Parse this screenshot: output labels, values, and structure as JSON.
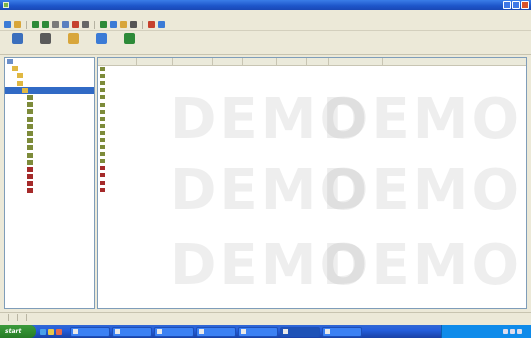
{
  "window": {
    "title": "",
    "controls": [
      "minimize-icon",
      "maximize-icon",
      "close-icon"
    ]
  },
  "menu": {
    "items": []
  },
  "toolbar_icons": [
    {
      "name": "new-icon",
      "color": "#3b7bd6"
    },
    {
      "name": "open-icon",
      "color": "#d8a63b"
    },
    {
      "name": "back-icon",
      "color": "#2d8a38"
    },
    {
      "name": "forward-icon",
      "color": "#2d8a38"
    },
    {
      "name": "cut-icon",
      "color": "#7a7a7a"
    },
    {
      "name": "copy-icon",
      "color": "#5a7fbf"
    },
    {
      "name": "delete-icon",
      "color": "#c6412d"
    },
    {
      "name": "properties-icon",
      "color": "#666666"
    },
    {
      "name": "refresh-icon",
      "color": "#2d8a38"
    },
    {
      "name": "find-icon",
      "color": "#3b7bd6"
    },
    {
      "name": "filter-icon",
      "color": "#d8a63b"
    },
    {
      "name": "print-icon",
      "color": "#555555"
    },
    {
      "name": "export-icon",
      "color": "#c6412d"
    },
    {
      "name": "help-icon",
      "color": "#3b7bd6"
    }
  ],
  "big_buttons": [
    {
      "name": "home-button",
      "label": "",
      "color": "#3b6fbd"
    },
    {
      "name": "tools-button",
      "label": "",
      "color": "#5a5a5a"
    },
    {
      "name": "filter-button",
      "label": "",
      "color": "#d8a63b"
    },
    {
      "name": "view-button",
      "label": "",
      "color": "#3b7bd6"
    },
    {
      "name": "stats-button",
      "label": "",
      "color": "#2d8a38"
    }
  ],
  "tree": {
    "items": [
      {
        "label": "",
        "indent": 0,
        "icon": "computer-icon",
        "color": "#6b8fc9",
        "selected": false
      },
      {
        "label": "",
        "indent": 1,
        "icon": "folder-icon",
        "color": "#e0b842",
        "selected": false
      },
      {
        "label": "",
        "indent": 2,
        "icon": "folder-icon",
        "color": "#e0b842",
        "selected": false
      },
      {
        "label": "",
        "indent": 2,
        "icon": "folder-icon",
        "color": "#e0b842",
        "selected": false
      },
      {
        "label": "",
        "indent": 3,
        "icon": "folder-icon",
        "color": "#e0b842",
        "selected": true
      },
      {
        "label": "",
        "indent": 4,
        "icon": "record-icon",
        "color": "#7d8b3a",
        "selected": false
      },
      {
        "label": "",
        "indent": 4,
        "icon": "record-icon",
        "color": "#7d8b3a",
        "selected": false
      },
      {
        "label": "",
        "indent": 4,
        "icon": "record-icon",
        "color": "#7d8b3a",
        "selected": false
      },
      {
        "label": "",
        "indent": 4,
        "icon": "record-icon",
        "color": "#7d8b3a",
        "selected": false
      },
      {
        "label": "",
        "indent": 4,
        "icon": "record-icon",
        "color": "#7d8b3a",
        "selected": false
      },
      {
        "label": "",
        "indent": 4,
        "icon": "record-icon",
        "color": "#7d8b3a",
        "selected": false
      },
      {
        "label": "",
        "indent": 4,
        "icon": "record-icon",
        "color": "#7d8b3a",
        "selected": false
      },
      {
        "label": "",
        "indent": 4,
        "icon": "record-icon",
        "color": "#7d8b3a",
        "selected": false
      },
      {
        "label": "",
        "indent": 4,
        "icon": "record-icon",
        "color": "#7d8b3a",
        "selected": false
      },
      {
        "label": "",
        "indent": 4,
        "icon": "record-icon",
        "color": "#7d8b3a",
        "selected": false
      },
      {
        "label": "",
        "indent": 4,
        "icon": "alert-record-icon",
        "color": "#a52a2a",
        "selected": false
      },
      {
        "label": "",
        "indent": 4,
        "icon": "alert-record-icon",
        "color": "#a52a2a",
        "selected": false
      },
      {
        "label": "",
        "indent": 4,
        "icon": "alert-record-icon",
        "color": "#a52a2a",
        "selected": false
      },
      {
        "label": "",
        "indent": 4,
        "icon": "alert-record-icon",
        "color": "#a52a2a",
        "selected": false
      }
    ]
  },
  "table": {
    "columns": [
      "",
      "",
      "",
      "",
      "",
      "",
      "",
      "",
      ""
    ],
    "rows": [
      {
        "icon_color": "#7d8b3a",
        "cells": [
          "",
          "",
          "",
          "",
          "",
          "",
          "",
          "",
          ""
        ]
      },
      {
        "icon_color": "#7d8b3a",
        "cells": [
          "",
          "",
          "",
          "",
          "",
          "",
          "",
          "",
          ""
        ]
      },
      {
        "icon_color": "#7d8b3a",
        "cells": [
          "",
          "",
          "",
          "",
          "",
          "",
          "",
          "",
          ""
        ]
      },
      {
        "icon_color": "#7d8b3a",
        "cells": [
          "",
          "",
          "",
          "",
          "",
          "",
          "",
          "",
          ""
        ]
      },
      {
        "icon_color": "#7d8b3a",
        "cells": [
          "",
          "",
          "",
          "",
          "",
          "",
          "",
          "",
          ""
        ]
      },
      {
        "icon_color": "#7d8b3a",
        "cells": [
          "",
          "",
          "",
          "",
          "",
          "",
          "",
          "",
          ""
        ]
      },
      {
        "icon_color": "#7d8b3a",
        "cells": [
          "",
          "",
          "",
          "",
          "",
          "",
          "",
          "",
          ""
        ]
      },
      {
        "icon_color": "#7d8b3a",
        "cells": [
          "",
          "",
          "",
          "",
          "",
          "",
          "",
          "",
          ""
        ]
      },
      {
        "icon_color": "#7d8b3a",
        "cells": [
          "",
          "",
          "",
          "",
          "",
          "",
          "",
          "",
          ""
        ]
      },
      {
        "icon_color": "#7d8b3a",
        "cells": [
          "",
          "",
          "",
          "",
          "",
          "",
          "",
          "",
          ""
        ]
      },
      {
        "icon_color": "#7d8b3a",
        "cells": [
          "",
          "",
          "",
          "",
          "",
          "",
          "",
          "",
          ""
        ]
      },
      {
        "icon_color": "#7d8b3a",
        "cells": [
          "",
          "",
          "",
          "",
          "",
          "",
          "",
          "",
          ""
        ]
      },
      {
        "icon_color": "#7d8b3a",
        "cells": [
          "",
          "",
          "",
          "",
          "",
          "",
          "",
          "",
          ""
        ]
      },
      {
        "icon_color": "#7d8b3a",
        "cells": [
          "",
          "",
          "",
          "",
          "",
          "",
          "",
          "",
          ""
        ]
      },
      {
        "icon_color": "#a52a2a",
        "cells": [
          "",
          "",
          "",
          "",
          "",
          "",
          "",
          "",
          ""
        ]
      },
      {
        "icon_color": "#a52a2a",
        "cells": [
          "",
          "",
          "",
          "",
          "",
          "",
          "",
          "",
          ""
        ]
      },
      {
        "icon_color": "#a52a2a",
        "cells": [
          "",
          "",
          "",
          "",
          "",
          "",
          "",
          "",
          ""
        ]
      },
      {
        "icon_color": "#a52a2a",
        "cells": [
          "",
          "",
          "",
          "",
          "",
          "",
          "",
          "",
          ""
        ]
      }
    ]
  },
  "watermark": {
    "text": "DEMO",
    "subtext": ""
  },
  "statusbar": {
    "segments": [
      "",
      "",
      ""
    ]
  },
  "taskbar": {
    "start_label": "start",
    "quicklaunch": [
      {
        "name": "browser-icon",
        "color": "#4aa0e8"
      },
      {
        "name": "desktop-icon",
        "color": "#e8c84a"
      },
      {
        "name": "media-icon",
        "color": "#e86a4a"
      }
    ],
    "tasks": [
      {
        "label": "",
        "active": false
      },
      {
        "label": "",
        "active": false
      },
      {
        "label": "",
        "active": false
      },
      {
        "label": "",
        "active": false
      },
      {
        "label": "",
        "active": false
      },
      {
        "label": "",
        "active": true
      },
      {
        "label": "",
        "active": false
      }
    ],
    "clock": ""
  }
}
